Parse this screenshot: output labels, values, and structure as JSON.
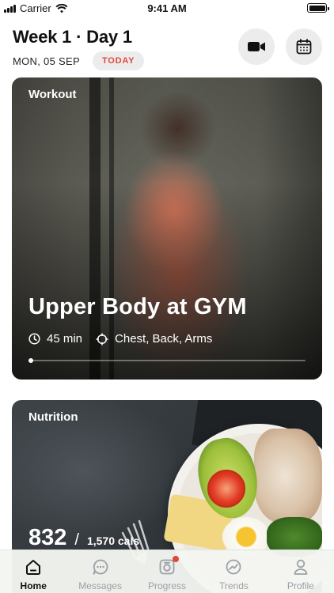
{
  "status_bar": {
    "carrier": "Carrier",
    "time": "9:41 AM"
  },
  "header": {
    "title": "Week 1 · Day 1",
    "date": "MON, 05 SEP",
    "today_badge": "TODAY",
    "video_button_icon": "video-camera-icon",
    "calendar_button_icon": "calendar-icon"
  },
  "workout_card": {
    "label": "Workout",
    "title": "Upper Body at GYM",
    "duration": "45 min",
    "muscles": "Chest, Back, Arms",
    "progress": 0.0
  },
  "nutrition_card": {
    "label": "Nutrition",
    "calories": "832",
    "separator": "/",
    "goal": "1,570 cals"
  },
  "tab_bar": {
    "tabs": [
      {
        "label": "Home",
        "icon": "home-icon",
        "active": true
      },
      {
        "label": "Messages",
        "icon": "chat-bubble-icon",
        "active": false
      },
      {
        "label": "Progress",
        "icon": "camera-icon",
        "active": false,
        "badge": true
      },
      {
        "label": "Trends",
        "icon": "trend-chart-icon",
        "active": false
      },
      {
        "label": "Profile",
        "icon": "person-icon",
        "active": false
      }
    ]
  },
  "colors": {
    "accent_red": "#e0483a",
    "pill_gray": "#ececec",
    "tab_inactive": "#9aa0a6"
  }
}
